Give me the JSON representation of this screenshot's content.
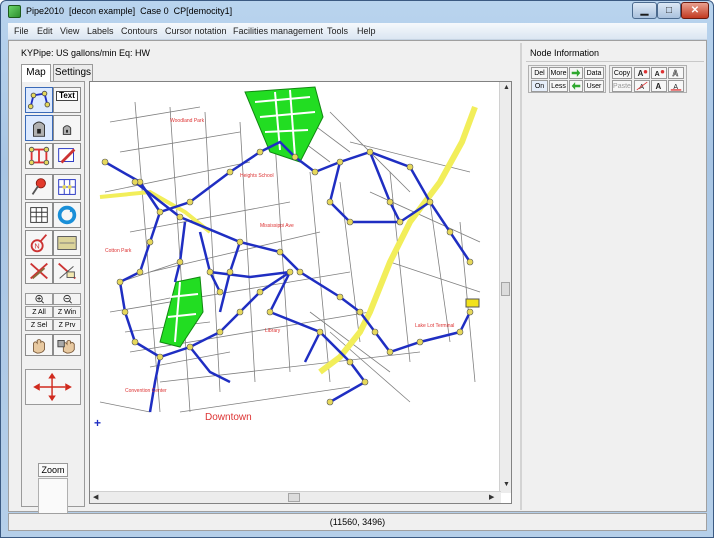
{
  "window": {
    "title": "Pipe2010  [decon example]  Case 0  CP[democity1]",
    "minimize": "▁",
    "maximize": "□",
    "close": "✕"
  },
  "menu": [
    "File",
    "Edit",
    "View",
    "Labels",
    "Contours",
    "Cursor notation",
    "Facilities management",
    "Tools",
    "Help"
  ],
  "info_line": "KYPipe: US gallons/min  Eq: HW",
  "tabs": [
    {
      "label": "Map",
      "active": true
    },
    {
      "label": "Settings",
      "active": false
    }
  ],
  "toolbar": {
    "text_tool": "Text",
    "zoom_buttons": [
      "Z All",
      "Z Win",
      "Z Sel",
      "Z Prv"
    ],
    "zoom_label": "Zoom"
  },
  "map": {
    "downtown_label": "Downtown",
    "colors": {
      "pipe": "#1f2ec2",
      "highway": "#f2ee5a",
      "park": "#22dd22",
      "node": "#e6d85a",
      "street": "#555555"
    }
  },
  "node_info": {
    "title": "Node Information",
    "buttons_row1": [
      "Del",
      "More",
      "Data"
    ],
    "buttons_row2": [
      "On",
      "Less",
      "User"
    ],
    "copy": "Copy",
    "paste": "Paste"
  },
  "status": {
    "coords": "(11560, 3496)"
  }
}
